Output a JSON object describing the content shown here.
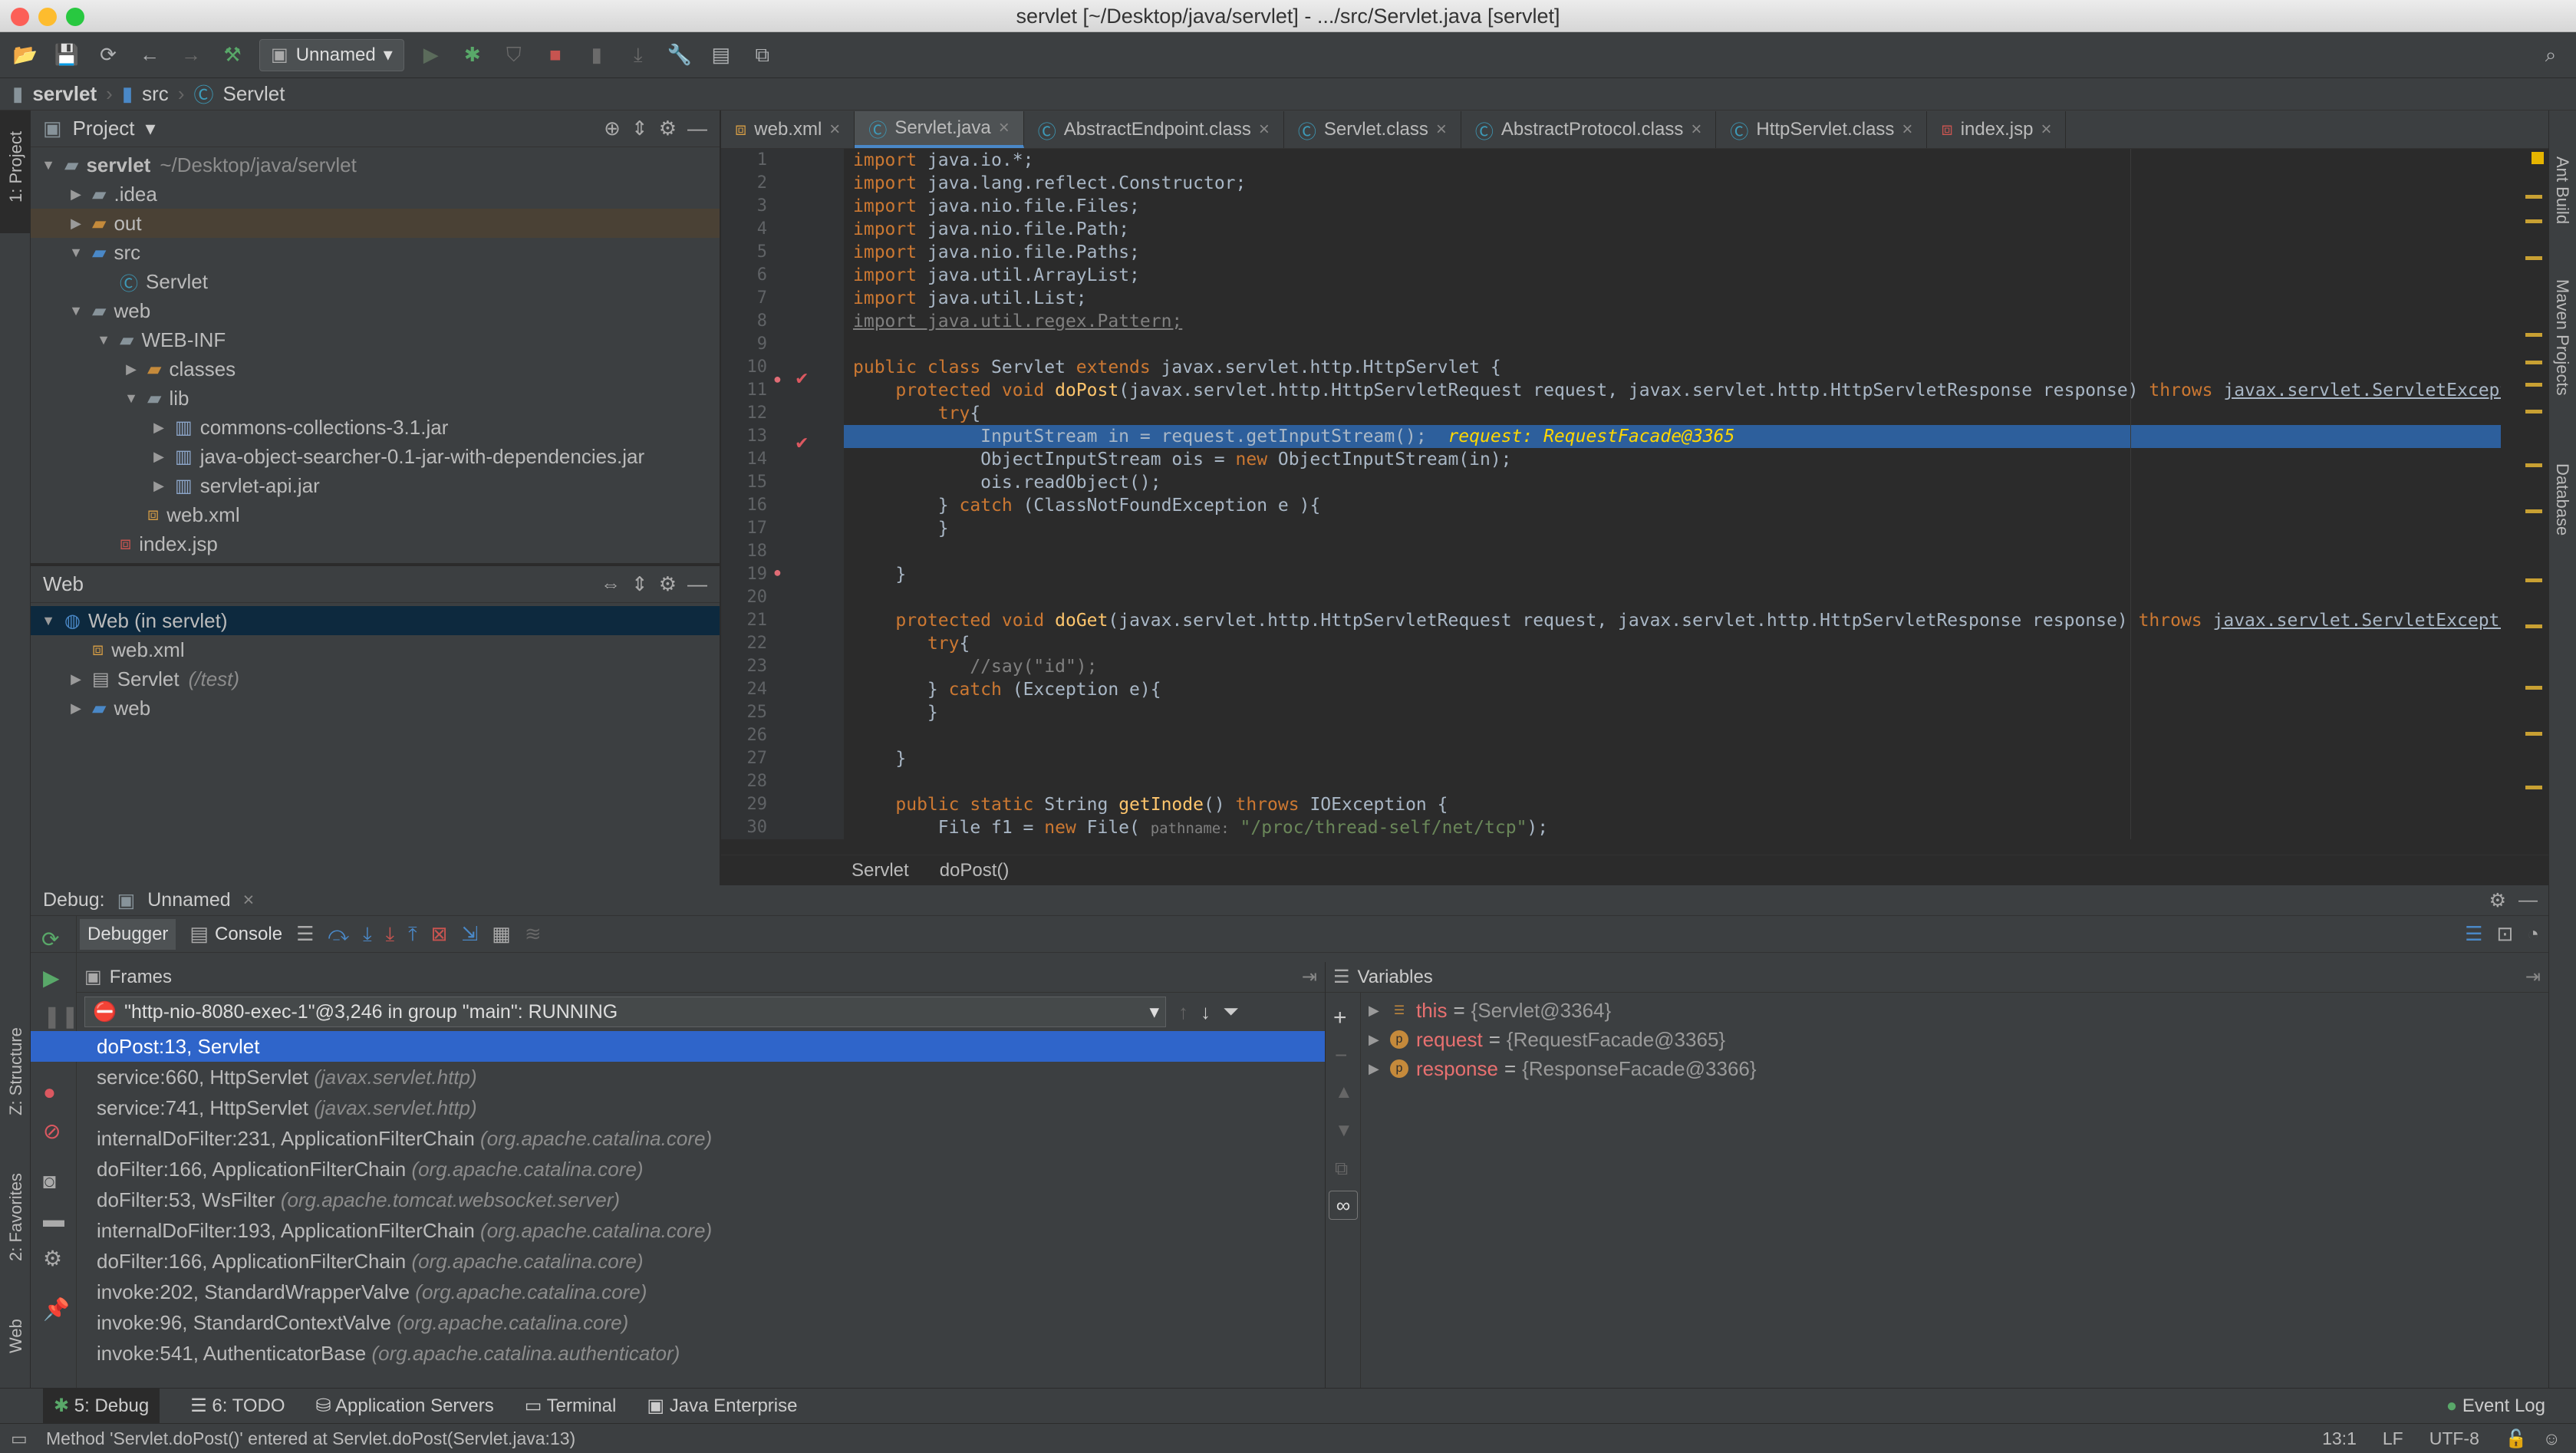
{
  "window": {
    "title": "servlet [~/Desktop/java/servlet] - .../src/Servlet.java [servlet]"
  },
  "toolbar": {
    "run_config": "Unnamed"
  },
  "navbar": {
    "items": [
      "servlet",
      "src",
      "Servlet"
    ]
  },
  "project_panel": {
    "title": "Project",
    "tree": [
      {
        "label": "servlet",
        "extra": "~/Desktop/java/servlet",
        "depth": 0,
        "arrow": "▼",
        "icon": "folder"
      },
      {
        "label": ".idea",
        "extra": "",
        "depth": 1,
        "arrow": "▶",
        "icon": "folder"
      },
      {
        "label": "out",
        "extra": "",
        "depth": 1,
        "arrow": "▶",
        "icon": "folder-orange"
      },
      {
        "label": "src",
        "extra": "",
        "depth": 1,
        "arrow": "▼",
        "icon": "folder-blue"
      },
      {
        "label": "Servlet",
        "extra": "",
        "depth": 2,
        "arrow": "",
        "icon": "class"
      },
      {
        "label": "web",
        "extra": "",
        "depth": 1,
        "arrow": "▼",
        "icon": "folder"
      },
      {
        "label": "WEB-INF",
        "extra": "",
        "depth": 2,
        "arrow": "▼",
        "icon": "folder"
      },
      {
        "label": "classes",
        "extra": "",
        "depth": 3,
        "arrow": "▶",
        "icon": "folder-orange"
      },
      {
        "label": "lib",
        "extra": "",
        "depth": 3,
        "arrow": "▼",
        "icon": "folder"
      },
      {
        "label": "commons-collections-3.1.jar",
        "extra": "",
        "depth": 4,
        "arrow": "▶",
        "icon": "jar"
      },
      {
        "label": "java-object-searcher-0.1-jar-with-dependencies.jar",
        "extra": "",
        "depth": 4,
        "arrow": "▶",
        "icon": "jar"
      },
      {
        "label": "servlet-api.jar",
        "extra": "",
        "depth": 4,
        "arrow": "▶",
        "icon": "jar"
      },
      {
        "label": "web.xml",
        "extra": "",
        "depth": 3,
        "arrow": "",
        "icon": "xml"
      },
      {
        "label": "index.jsp",
        "extra": "",
        "depth": 2,
        "arrow": "",
        "icon": "jsp"
      }
    ]
  },
  "web_panel": {
    "title": "Web",
    "tree": [
      {
        "label": "Web (in servlet)",
        "extra": "",
        "depth": 0,
        "arrow": "▼",
        "icon": "web"
      },
      {
        "label": "web.xml",
        "extra": "",
        "depth": 1,
        "arrow": "",
        "icon": "xml"
      },
      {
        "label": "Servlet",
        "extra": "(/test)",
        "depth": 1,
        "arrow": "▶",
        "icon": "servlet"
      },
      {
        "label": "web",
        "extra": "",
        "depth": 1,
        "arrow": "▶",
        "icon": "folder-blue"
      }
    ]
  },
  "editor": {
    "tabs": [
      {
        "label": "web.xml",
        "icon": "xml"
      },
      {
        "label": "Servlet.java",
        "icon": "class",
        "active": true
      },
      {
        "label": "AbstractEndpoint.class",
        "icon": "class"
      },
      {
        "label": "Servlet.class",
        "icon": "class"
      },
      {
        "label": "AbstractProtocol.class",
        "icon": "class"
      },
      {
        "label": "HttpServlet.class",
        "icon": "class"
      },
      {
        "label": "index.jsp",
        "icon": "jsp"
      }
    ],
    "breadcrumb": [
      "Servlet",
      "doPost()"
    ]
  },
  "debug": {
    "label": "Debug:",
    "session": "Unnamed",
    "tab_debugger": "Debugger",
    "tab_console": "Console",
    "frames_title": "Frames",
    "thread": "\"http-nio-8080-exec-1\"@3,246 in group \"main\": RUNNING",
    "frames": [
      {
        "method": "doPost:13, Servlet",
        "pkg": ""
      },
      {
        "method": "service:660, HttpServlet",
        "pkg": "(javax.servlet.http)"
      },
      {
        "method": "service:741, HttpServlet",
        "pkg": "(javax.servlet.http)"
      },
      {
        "method": "internalDoFilter:231, ApplicationFilterChain",
        "pkg": "(org.apache.catalina.core)"
      },
      {
        "method": "doFilter:166, ApplicationFilterChain",
        "pkg": "(org.apache.catalina.core)"
      },
      {
        "method": "doFilter:53, WsFilter",
        "pkg": "(org.apache.tomcat.websocket.server)"
      },
      {
        "method": "internalDoFilter:193, ApplicationFilterChain",
        "pkg": "(org.apache.catalina.core)"
      },
      {
        "method": "doFilter:166, ApplicationFilterChain",
        "pkg": "(org.apache.catalina.core)"
      },
      {
        "method": "invoke:202, StandardWrapperValve",
        "pkg": "(org.apache.catalina.core)"
      },
      {
        "method": "invoke:96, StandardContextValve",
        "pkg": "(org.apache.catalina.core)"
      },
      {
        "method": "invoke:541, AuthenticatorBase",
        "pkg": "(org.apache.catalina.authenticator)"
      }
    ],
    "variables_title": "Variables",
    "variables": [
      {
        "name": "this",
        "value": "{Servlet@3364}",
        "icon": "fields"
      },
      {
        "name": "request",
        "value": "{RequestFacade@3365}",
        "icon": "p"
      },
      {
        "name": "response",
        "value": "{ResponseFacade@3366}",
        "icon": "p"
      }
    ]
  },
  "bottom_tabs": [
    "5: Debug",
    "6: TODO",
    "Application Servers",
    "Terminal",
    "Java Enterprise"
  ],
  "event_log": "Event Log",
  "status": {
    "message": "Method 'Servlet.doPost()' entered at Servlet.doPost(Servlet.java:13)",
    "position": "13:1",
    "line_sep": "LF",
    "encoding": "UTF-8"
  },
  "side_tabs": {
    "left": [
      "1: Project",
      "2: Favorites",
      "Z: Structure",
      "Web"
    ],
    "right": [
      "Ant Build",
      "Maven Projects",
      "Database"
    ]
  },
  "colors": {
    "selection": "#2f65ca",
    "code_highlight": "#2d5f9c",
    "keyword": "#cc7832",
    "method": "#ffc66d",
    "string": "#6a8759"
  }
}
